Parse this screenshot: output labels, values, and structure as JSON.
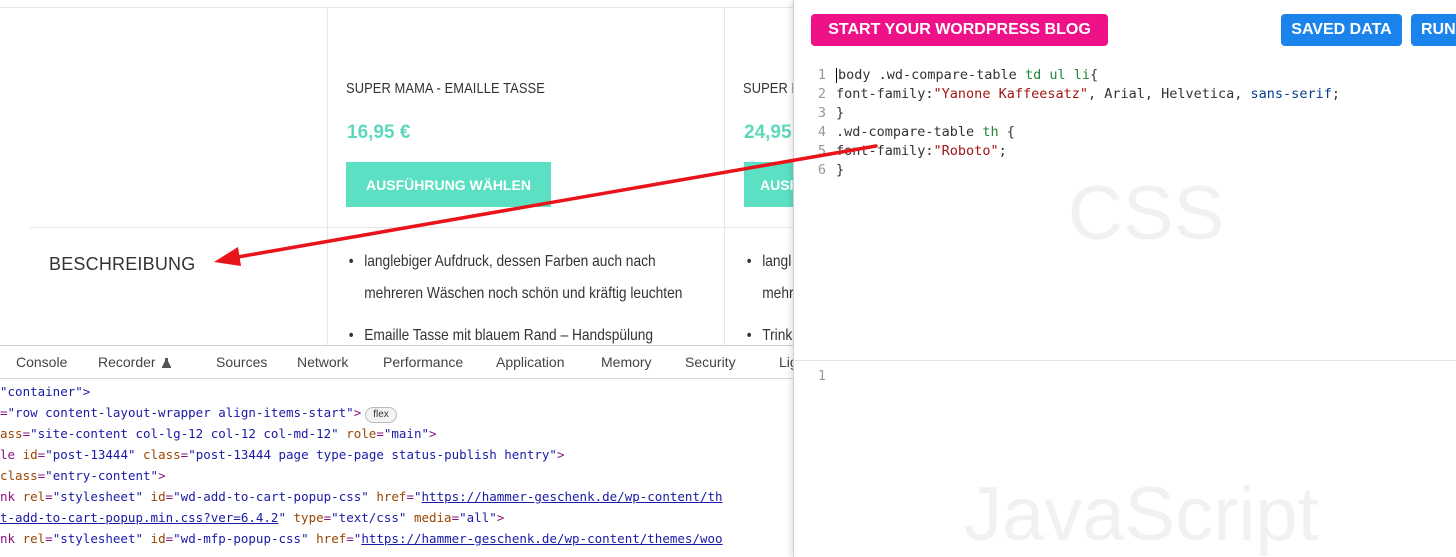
{
  "table": {
    "columns": [
      {
        "title": "SUPER MAMA - EMAILLE TASSE",
        "price": "16,95 €",
        "button": "AUSFÜHRUNG WÄHLEN",
        "bullets": [
          "langlebiger Aufdruck, dessen Farben auch nach mehreren Wäschen noch schön und kräftig leuchten",
          "Emaille Tasse mit blauem Rand – Handspülung"
        ]
      },
      {
        "title": "SUPER MAMA",
        "price": "24,95",
        "button": "AUSF",
        "bullets": [
          "langl mehr",
          "Trink"
        ]
      }
    ],
    "row_label": "BESCHREIBUNG"
  },
  "devtools": {
    "tabs": [
      "Console",
      "Recorder",
      "Sources",
      "Network",
      "Performance",
      "Application",
      "Memory",
      "Security",
      "Lig"
    ],
    "flex_badge": "flex",
    "dom_lines": [
      {
        "pre": "",
        "tag": "container",
        "rest": "\">"
      },
      {
        "pre": "=",
        "val": "\"row content-layout-wrapper align-items-start\"",
        "close": ">"
      },
      {
        "a1": "ass",
        "v1": "\"site-content col-lg-12 col-12 col-md-12\"",
        "a2": "role",
        "v2": "\"main\"",
        "close": ">"
      },
      {
        "t": "le",
        "a1": "id",
        "v1": "\"post-13444\"",
        "a2": "class",
        "v2": "\"post-13444 page type-page status-publish hentry\"",
        "close": ">"
      },
      {
        "t": "",
        "a1": "class",
        "v1": "\"entry-content\"",
        "close": ">"
      },
      {
        "t": "nk",
        "a1": "rel",
        "v1": "\"stylesheet\"",
        "a2": "id",
        "v2": "\"wd-add-to-cart-popup-css\"",
        "a3": "href",
        "link": "https://hammer-geschenk.de/wp-content/th"
      },
      {
        "link": "t-add-to-cart-popup.min.css?ver=6.4.2",
        "a2": "type",
        "v2": "\"text/css\"",
        "a3": "media",
        "v3": "\"all\"",
        "close": ">"
      },
      {
        "t": "nk",
        "a1": "rel",
        "v1": "\"stylesheet\"",
        "a2": "id",
        "v2": "\"wd-mfp-popup-css\"",
        "a3": "href",
        "link": "https://hammer-geschenk.de/wp-content/themes/woo"
      }
    ]
  },
  "editor": {
    "wp_button": "START YOUR WORDPRESS BLOG",
    "saved_button": "SAVED DATA",
    "run_button": "RUN",
    "css_watermark": "CSS",
    "js_watermark": "JavaScript",
    "css_lines": [
      {
        "n": "1",
        "sel": "body .wd-compare-table ",
        "tags": "td ul li",
        "tail": "{"
      },
      {
        "n": "2",
        "prop": "font-family:",
        "s1": "\"Yanone Kaffeesatz\"",
        "mid": ", Arial, Helvetica, ",
        "kw": "sans-serif",
        "end": ";"
      },
      {
        "n": "3",
        "plain": "}"
      },
      {
        "n": "4",
        "sel": ".wd-compare-table ",
        "tags": "th",
        "tail": " {"
      },
      {
        "n": "5",
        "prop": "font-family:",
        "s1": "\"Roboto\"",
        "end": ";"
      },
      {
        "n": "6",
        "plain": "}"
      }
    ],
    "js_line_number": "1"
  },
  "colors": {
    "accent_teal": "#5ce0c4",
    "price_teal": "#5ed8bd",
    "wp_pink": "#ee1187",
    "blue": "#1a84ec",
    "arrow_red": "#e8141a"
  }
}
